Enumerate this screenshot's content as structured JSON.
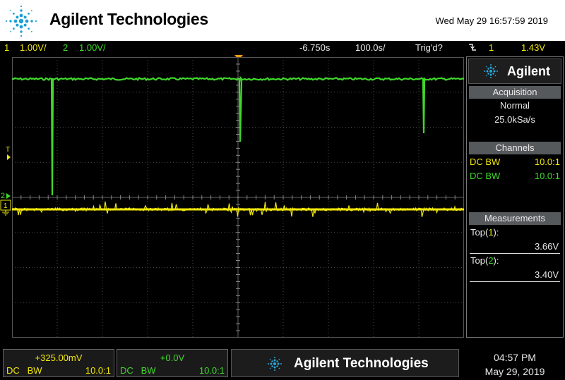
{
  "header": {
    "brand": "Agilent Technologies",
    "datetime": "Wed May 29 16:57:59 2019",
    "logo_icon": "agilent-spark-icon"
  },
  "status_bar": {
    "ch1_num": "1",
    "ch1_scale": "1.00V/",
    "ch2_num": "2",
    "ch2_scale": "1.00V/",
    "time_delay": "-6.750s",
    "time_scale": "100.0s/",
    "trigger_status": "Trig'd?",
    "trigger_icon": "trigger-edge-falling-icon",
    "trigger_source": "1",
    "trigger_level": "1.43V"
  },
  "screen": {
    "ch1_color": "#f0e60a",
    "ch2_color": "#3fd82b",
    "trigger_marker": "T",
    "ch1_marker": "1",
    "ch2_marker": "2",
    "ground_icon": "ground-icon"
  },
  "side_panel": {
    "logo_text": "Agilent",
    "acquisition": {
      "title": "Acquisition",
      "mode": "Normal",
      "rate": "25.0kSa/s"
    },
    "channels": {
      "title": "Channels",
      "rows": [
        {
          "coupling": "DC BW",
          "probe": "10.0:1"
        },
        {
          "coupling": "DC BW",
          "probe": "10.0:1"
        }
      ]
    },
    "measurements": {
      "title": "Measurements",
      "items": [
        {
          "label": "Top",
          "channel": "1",
          "value": "3.66V"
        },
        {
          "label": "Top",
          "channel": "2",
          "value": "3.40V"
        }
      ]
    }
  },
  "bottom_bar": {
    "ch1": {
      "offset": "+325.00mV",
      "coupling": "DC   BW",
      "probe": "10.0:1"
    },
    "ch2": {
      "offset": "+0.0V",
      "coupling": "DC   BW",
      "probe": "10.0:1"
    },
    "brand": "Agilent Technologies",
    "time": "04:57 PM",
    "date": "May 29, 2019"
  }
}
